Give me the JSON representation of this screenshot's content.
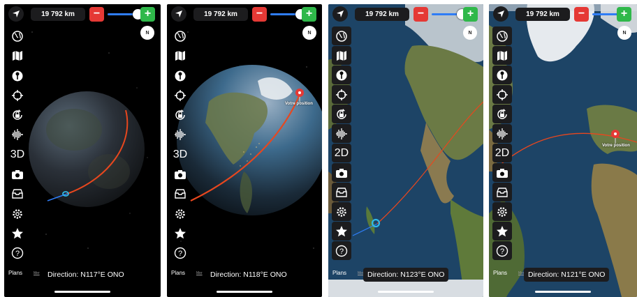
{
  "screens": [
    {
      "distance": "19 792 km",
      "mode": "3D",
      "direction": "Direction: N117°E  ONO",
      "compass": "N",
      "plans": "Plans",
      "legal": "Mer",
      "pin_label": ""
    },
    {
      "distance": "19 792 km",
      "mode": "3D",
      "direction": "Direction: N118°E  ONO",
      "compass": "N",
      "plans": "Plans",
      "legal": "Mer",
      "pin_label": "Votre position"
    },
    {
      "distance": "19 792 km",
      "mode": "2D",
      "direction": "Direction: N123°E  ONO",
      "compass": "N",
      "plans": "Plans",
      "legal": "Mer",
      "pin_label": ""
    },
    {
      "distance": "19 792 km",
      "mode": "2D",
      "direction": "Direction: N121°E  ONO",
      "compass": "N",
      "plans": "Plans",
      "legal": "Mer",
      "pin_label": "Votre position"
    }
  ],
  "controls": {
    "minus": "−",
    "plus": "+"
  },
  "colors": {
    "route": "#e8471e",
    "accent": "#2f7df6",
    "minus": "#e53935",
    "plus": "#2fb84a"
  },
  "icons": [
    "globe-icon",
    "map-icon",
    "pin-icon",
    "target-icon",
    "rotation-lock-icon",
    "audio-wave-icon",
    "view-mode-toggle",
    "camera-icon",
    "inbox-icon",
    "gear-icon",
    "star-icon",
    "help-icon"
  ]
}
